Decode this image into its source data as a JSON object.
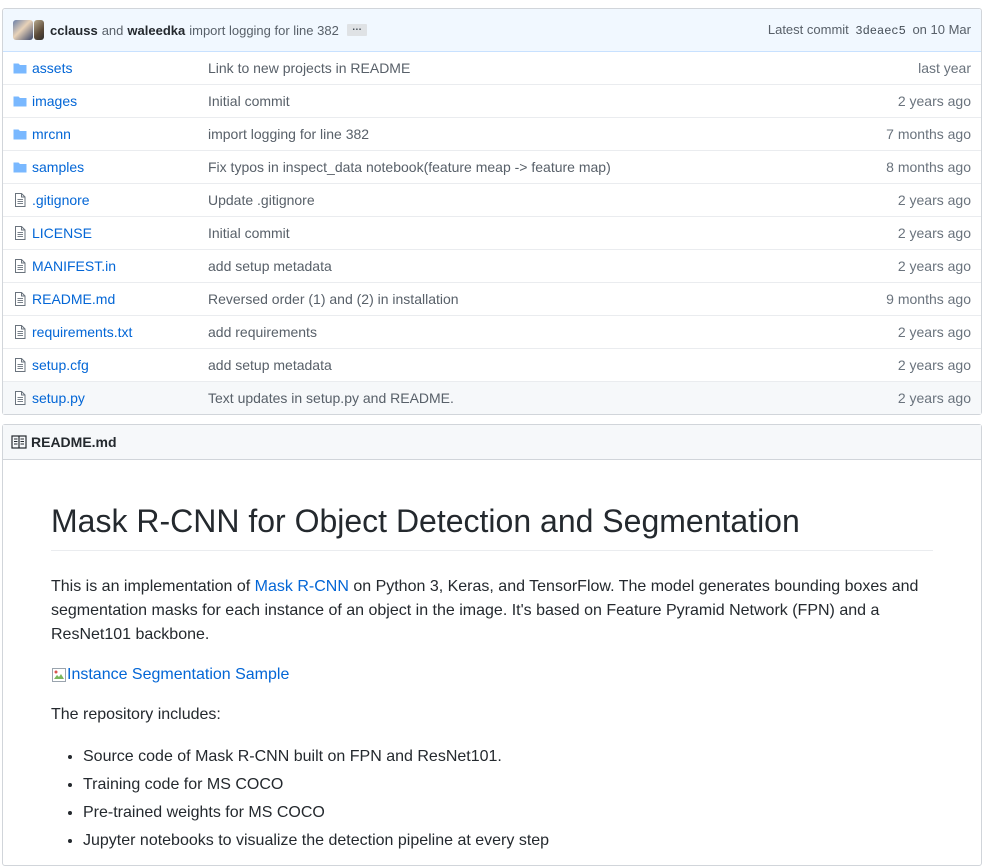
{
  "commit": {
    "author1": "cclauss",
    "and": "and",
    "author2": "waleedka",
    "message": "import logging for line 382",
    "ellipsis": "…",
    "latest_label": "Latest commit",
    "sha": "3deaec5",
    "date": "on 10 Mar"
  },
  "files": [
    {
      "type": "folder",
      "name": "assets",
      "message": "Link to new projects in README",
      "age": "last year"
    },
    {
      "type": "folder",
      "name": "images",
      "message": "Initial commit",
      "age": "2 years ago"
    },
    {
      "type": "folder",
      "name": "mrcnn",
      "message": "import logging for line 382",
      "age": "7 months ago"
    },
    {
      "type": "folder",
      "name": "samples",
      "message": "Fix typos in inspect_data notebook(feature meap -> feature map)",
      "age": "8 months ago"
    },
    {
      "type": "file",
      "name": ".gitignore",
      "message": "Update .gitignore",
      "age": "2 years ago"
    },
    {
      "type": "file",
      "name": "LICENSE",
      "message": "Initial commit",
      "age": "2 years ago"
    },
    {
      "type": "file",
      "name": "MANIFEST.in",
      "message": "add setup metadata",
      "age": "2 years ago"
    },
    {
      "type": "file",
      "name": "README.md",
      "message": "Reversed order (1) and (2) in installation",
      "age": "9 months ago"
    },
    {
      "type": "file",
      "name": "requirements.txt",
      "message": "add requirements",
      "age": "2 years ago"
    },
    {
      "type": "file",
      "name": "setup.cfg",
      "message": "add setup metadata",
      "age": "2 years ago"
    },
    {
      "type": "file",
      "name": "setup.py",
      "message": "Text updates in setup.py and README.",
      "age": "2 years ago"
    }
  ],
  "readme": {
    "header": "README.md",
    "title": "Mask R-CNN for Object Detection and Segmentation",
    "intro_pre": "This is an implementation of ",
    "intro_link": "Mask R-CNN",
    "intro_post": " on Python 3, Keras, and TensorFlow. The model generates bounding boxes and segmentation masks for each instance of an object in the image. It's based on Feature Pyramid Network (FPN) and a ResNet101 backbone.",
    "image_alt": "Instance Segmentation Sample",
    "includes_label": "The repository includes:",
    "items": [
      "Source code of Mask R-CNN built on FPN and ResNet101.",
      "Training code for MS COCO",
      "Pre-trained weights for MS COCO",
      "Jupyter notebooks to visualize the detection pipeline at every step"
    ]
  },
  "colors": {
    "link": "#0366d6",
    "folder_icon": "#79b8ff",
    "file_icon": "#6a737d",
    "commit_bar_bg": "#f1f8ff"
  },
  "icons": {
    "folder": "folder-icon",
    "file": "file-icon",
    "readme_header": "book-icon",
    "broken_image": "broken-image-icon"
  }
}
